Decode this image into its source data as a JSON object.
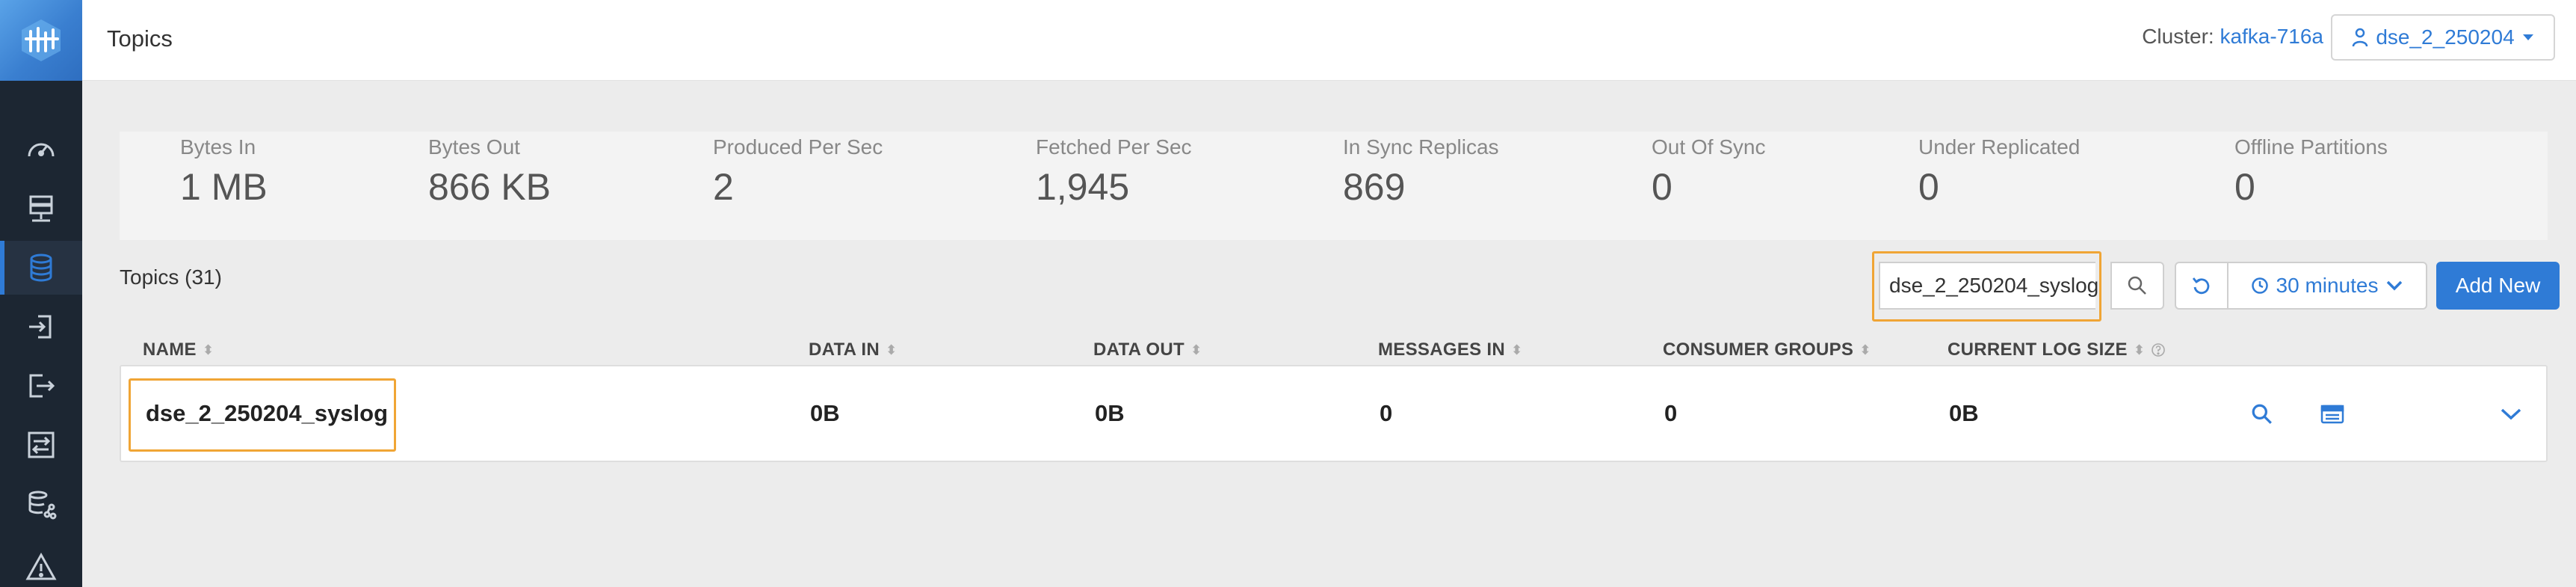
{
  "header": {
    "title": "Topics",
    "cluster_label": "Cluster:",
    "cluster_name": "kafka-716a",
    "user": "dse_2_250204"
  },
  "sidebar": {
    "items": [
      {
        "name": "dashboard",
        "icon": "speedometer-icon"
      },
      {
        "name": "brokers",
        "icon": "server-icon"
      },
      {
        "name": "topics",
        "icon": "database-icon",
        "active": true
      },
      {
        "name": "producers",
        "icon": "login-icon"
      },
      {
        "name": "consumers",
        "icon": "logout-icon"
      },
      {
        "name": "replication",
        "icon": "transfer-icon"
      },
      {
        "name": "topology",
        "icon": "database-share-icon"
      },
      {
        "name": "alerts",
        "icon": "warning-icon"
      }
    ]
  },
  "stats": [
    {
      "label": "Bytes In",
      "value": "1 MB"
    },
    {
      "label": "Bytes Out",
      "value": "866 KB"
    },
    {
      "label": "Produced Per Sec",
      "value": "2"
    },
    {
      "label": "Fetched Per Sec",
      "value": "1,945"
    },
    {
      "label": "In Sync Replicas",
      "value": "869"
    },
    {
      "label": "Out Of Sync",
      "value": "0"
    },
    {
      "label": "Under Replicated",
      "value": "0"
    },
    {
      "label": "Offline Partitions",
      "value": "0"
    }
  ],
  "topics": {
    "count_label": "Topics (31)",
    "search_value": "dse_2_250204_syslog",
    "time_range": "30 minutes",
    "add_label": "Add New"
  },
  "table": {
    "columns": [
      "NAME",
      "DATA IN",
      "DATA OUT",
      "MESSAGES IN",
      "CONSUMER GROUPS",
      "CURRENT LOG SIZE"
    ],
    "rows": [
      {
        "name": "dse_2_250204_syslog",
        "data_in": "0B",
        "data_out": "0B",
        "messages_in": "0",
        "consumer_groups": "0",
        "log_size": "0B"
      }
    ]
  },
  "colors": {
    "accent": "#2f7bd6",
    "highlight": "#f0a535",
    "sidebar": "#1c2632"
  }
}
